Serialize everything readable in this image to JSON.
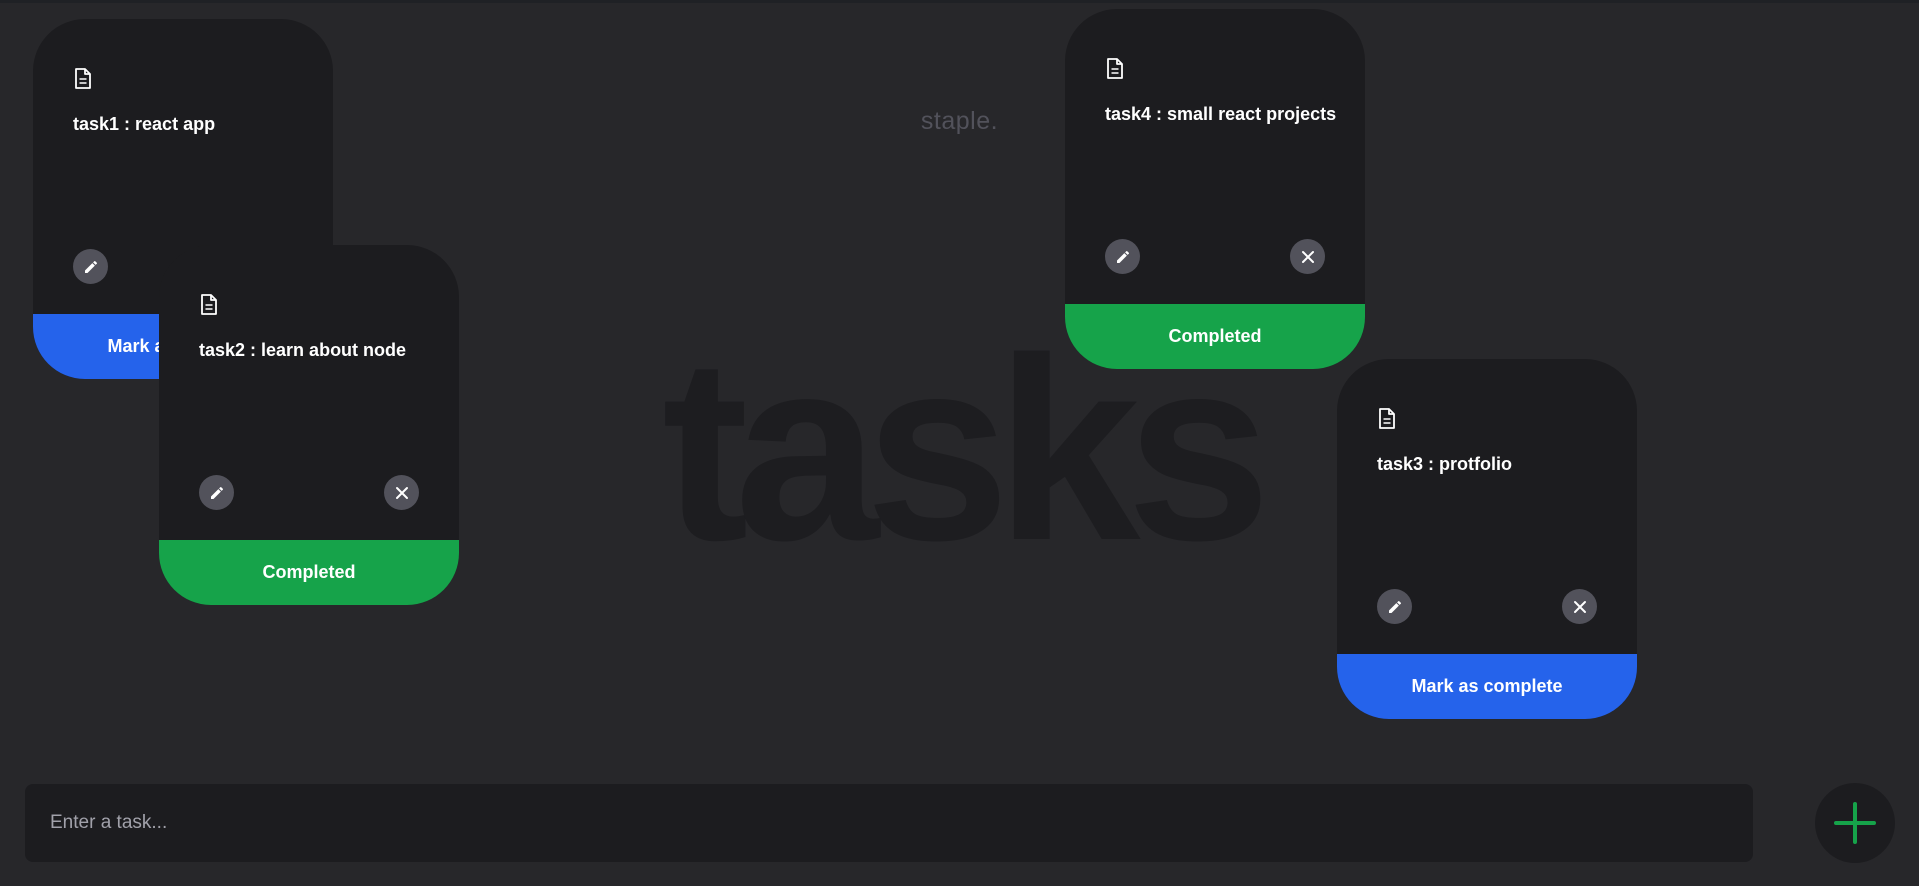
{
  "app": {
    "brand": "staple.",
    "background_title": "tasks"
  },
  "tasks": [
    {
      "id": "task1",
      "text": "task1 : react app",
      "status_label": "Mark as complete",
      "status": "pending"
    },
    {
      "id": "task2",
      "text": "task2 : learn about node",
      "status_label": "Completed",
      "status": "completed"
    },
    {
      "id": "task4",
      "text": "task4 : small react projects",
      "status_label": "Completed",
      "status": "completed"
    },
    {
      "id": "task3",
      "text": "task3 : protfolio",
      "status_label": "Mark as complete",
      "status": "pending"
    }
  ],
  "icons": {
    "document": "document-icon",
    "edit": "pencil-icon",
    "delete": "close-icon",
    "add": "plus-icon"
  },
  "input": {
    "value": "",
    "placeholder": "Enter a task..."
  },
  "colors": {
    "background": "#27272a",
    "card": "#1c1c1f",
    "pending": "#2563eb",
    "completed": "#16a34a",
    "add_icon": "#16a34a",
    "icon_button": "#52525b"
  }
}
